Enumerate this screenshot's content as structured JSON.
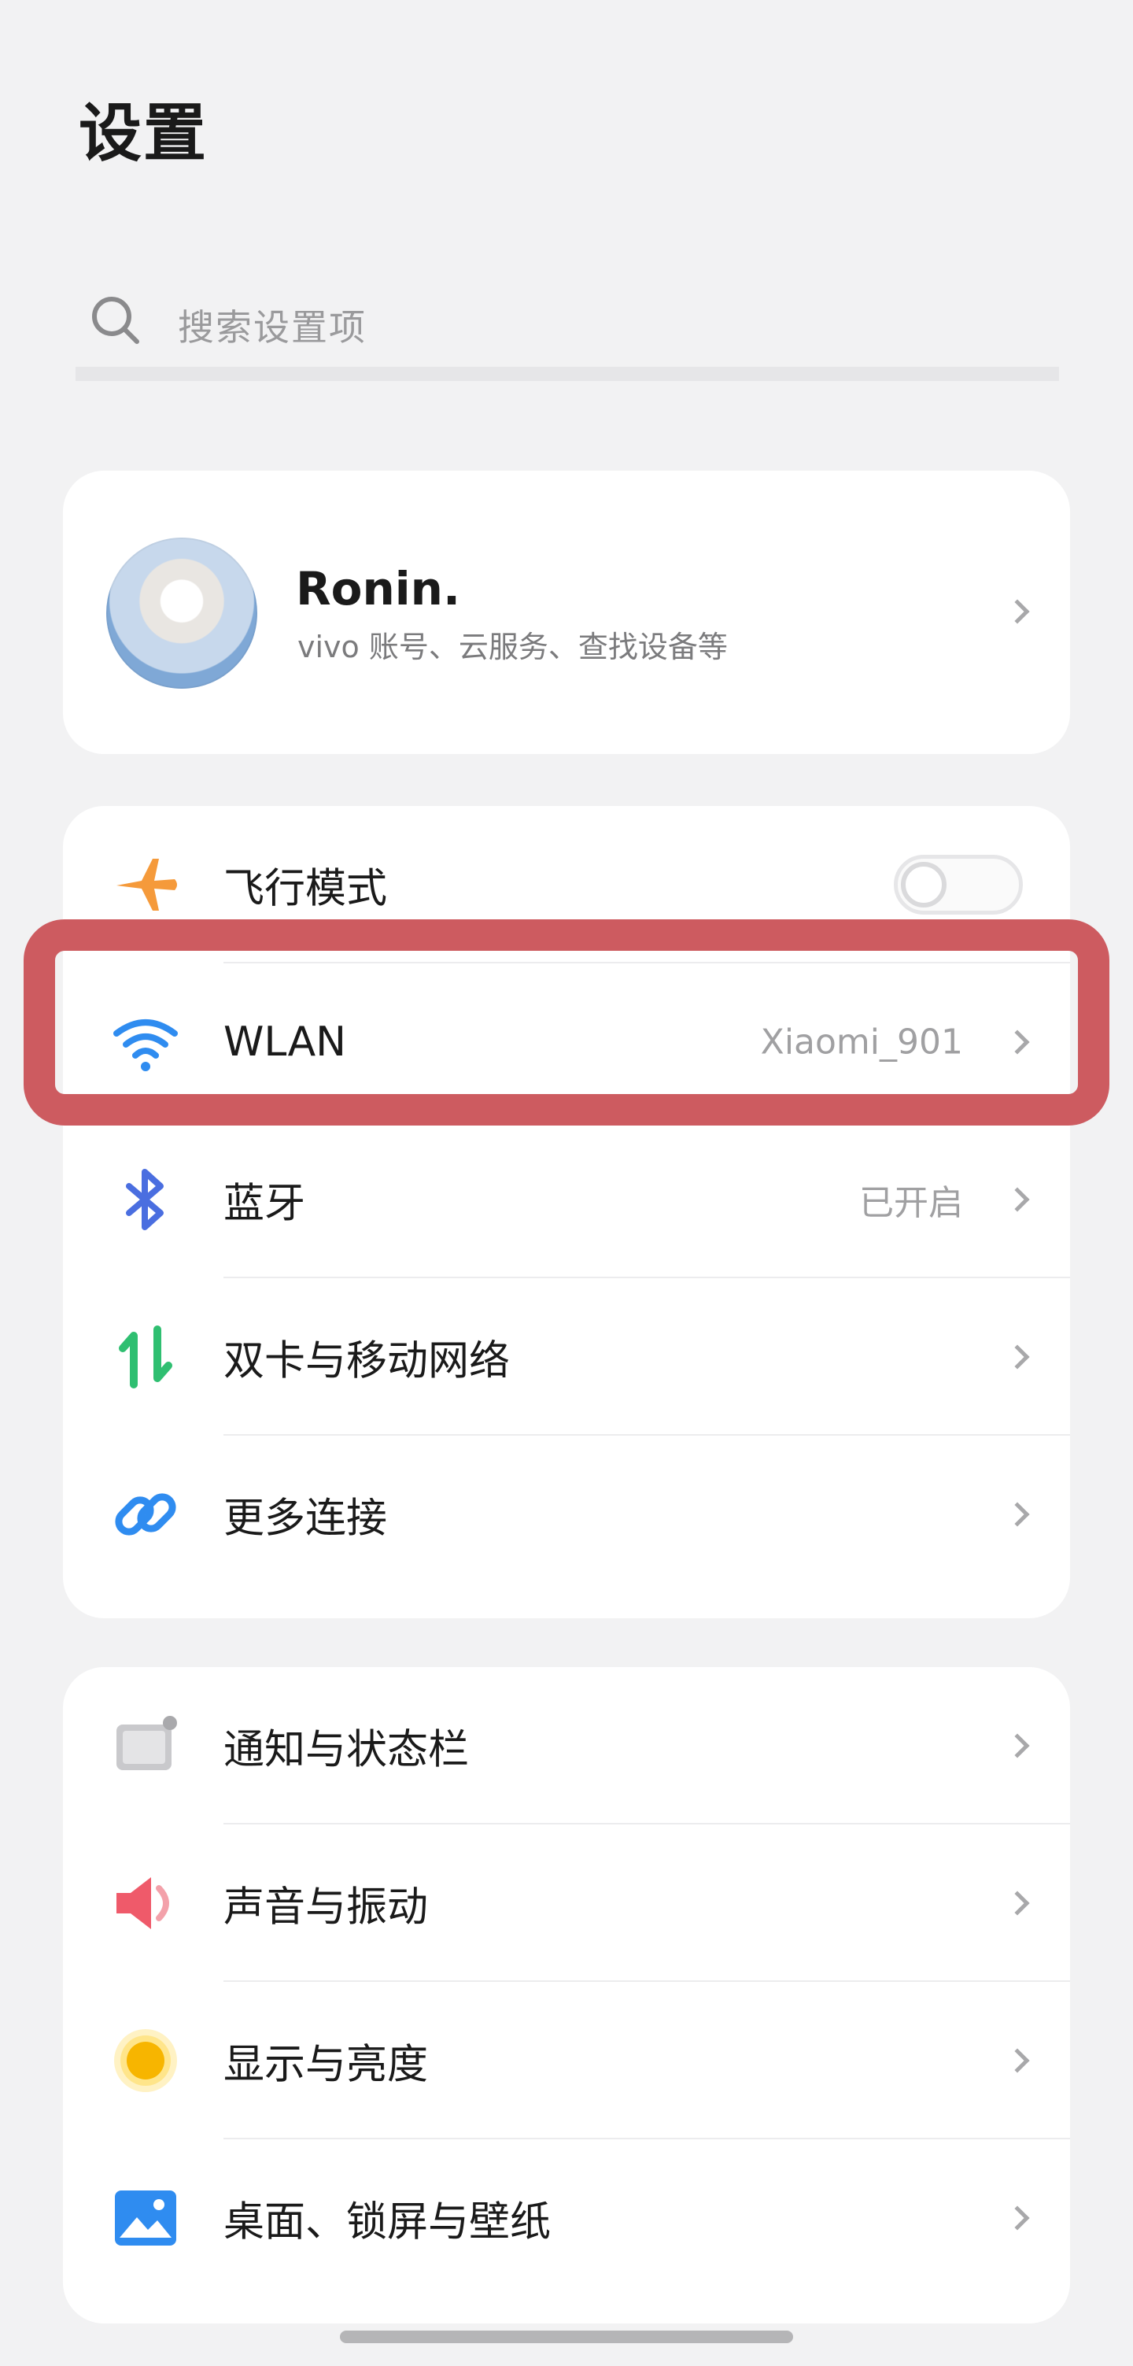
{
  "header": {
    "title": "设置"
  },
  "search": {
    "placeholder": "搜索设置项",
    "icon": "search-icon"
  },
  "account": {
    "name": "Ronin.",
    "subtitle": "vivo 账号、云服务、查找设备等"
  },
  "connectivity": [
    {
      "label": "飞行模式",
      "icon": "airplane-icon",
      "toggle": "off"
    },
    {
      "label": "WLAN",
      "icon": "wifi-icon",
      "value": "Xiaomi_901"
    },
    {
      "label": "蓝牙",
      "icon": "bluetooth-icon",
      "value": "已开启"
    },
    {
      "label": "双卡与移动网络",
      "icon": "mobile-network-icon"
    },
    {
      "label": "更多连接",
      "icon": "link-icon"
    }
  ],
  "settings": [
    {
      "label": "通知与状态栏",
      "icon": "notification-icon"
    },
    {
      "label": "声音与振动",
      "icon": "speaker-icon"
    },
    {
      "label": "显示与亮度",
      "icon": "brightness-icon"
    },
    {
      "label": "桌面、锁屏与壁纸",
      "icon": "wallpaper-icon"
    }
  ],
  "colors": {
    "background": "#f2f2f3",
    "card": "#ffffff",
    "highlight": "#cd5b60",
    "wifi": "#2f8cf0",
    "bluetooth": "#4a6ee0",
    "mobile_network": "#2fbf71",
    "airplane": "#f59a3b",
    "speaker": "#ef5a6a",
    "brightness": "#f7b500"
  }
}
